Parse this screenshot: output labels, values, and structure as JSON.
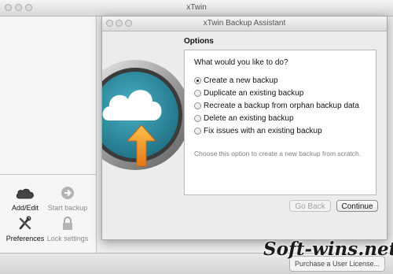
{
  "main_window": {
    "title": "xTwin",
    "sidebar": {
      "items": [
        {
          "label": "Add/Edit",
          "icon": "cloud-icon",
          "enabled": true
        },
        {
          "label": "Start backup",
          "icon": "arrow-circle-icon",
          "enabled": false
        },
        {
          "label": "Preferences",
          "icon": "tools-icon",
          "enabled": true
        },
        {
          "label": "Lock settings",
          "icon": "padlock-icon",
          "enabled": false
        }
      ]
    },
    "purchase_button": "Purchase a User License..."
  },
  "dialog": {
    "title": "xTwin Backup Assistant",
    "options_heading": "Options",
    "question": "What would you like to do?",
    "options": [
      {
        "label": "Create a new backup",
        "selected": true
      },
      {
        "label": "Duplicate an existing backup",
        "selected": false
      },
      {
        "label": "Recreate a backup from orphan backup data",
        "selected": false
      },
      {
        "label": "Delete an existing backup",
        "selected": false
      },
      {
        "label": "Fix issues with an existing backup",
        "selected": false
      }
    ],
    "hint": "Choose this option to create a new backup from scratch.",
    "buttons": {
      "back": "Go Back",
      "continue": "Continue"
    }
  },
  "watermark": "Soft-wins.net",
  "colors": {
    "accent_orange": "#f29b1e",
    "teal": "#2f8fa6",
    "desktop": "#3f6f8c"
  }
}
